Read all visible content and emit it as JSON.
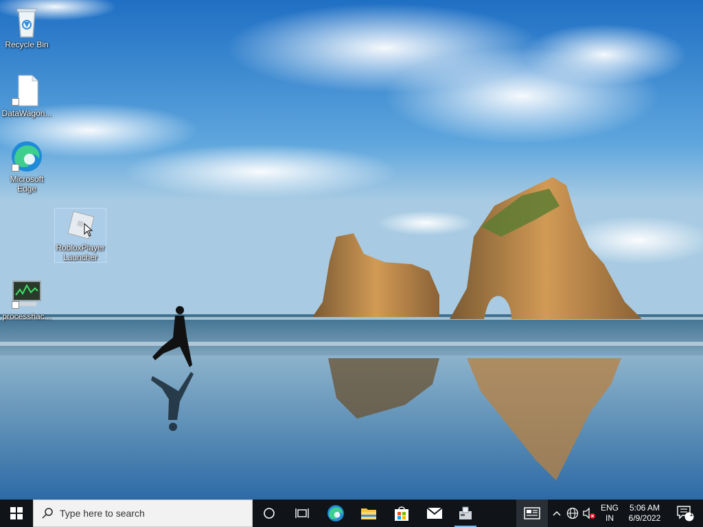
{
  "desktop": {
    "icons": [
      {
        "label": "Recycle Bin",
        "icon": "recycle-bin-icon"
      },
      {
        "label": "DataWagon...",
        "icon": "document-icon"
      },
      {
        "label": "Microsoft Edge",
        "icon": "edge-icon"
      },
      {
        "label": "RobloxPlayer Launcher",
        "icon": "roblox-icon"
      },
      {
        "label": "processhac...",
        "icon": "process-hacker-icon"
      }
    ],
    "selected_icon": "RobloxPlayer Launcher"
  },
  "taskbar": {
    "search_placeholder": "Type here to search",
    "pinned": [
      "start-icon",
      "cortana-icon",
      "task-view-icon",
      "edge-icon",
      "file-explorer-icon",
      "microsoft-store-icon",
      "mail-icon",
      "roblox-app-icon"
    ],
    "tray": {
      "language_line1": "ENG",
      "language_line2": "IN",
      "time": "5:06 AM",
      "date": "6/9/2022",
      "notification_count": "1"
    }
  },
  "colors": {
    "taskbar_bg": "#101418",
    "search_bg": "#f2f2f2",
    "accent": "#76b9ed"
  }
}
